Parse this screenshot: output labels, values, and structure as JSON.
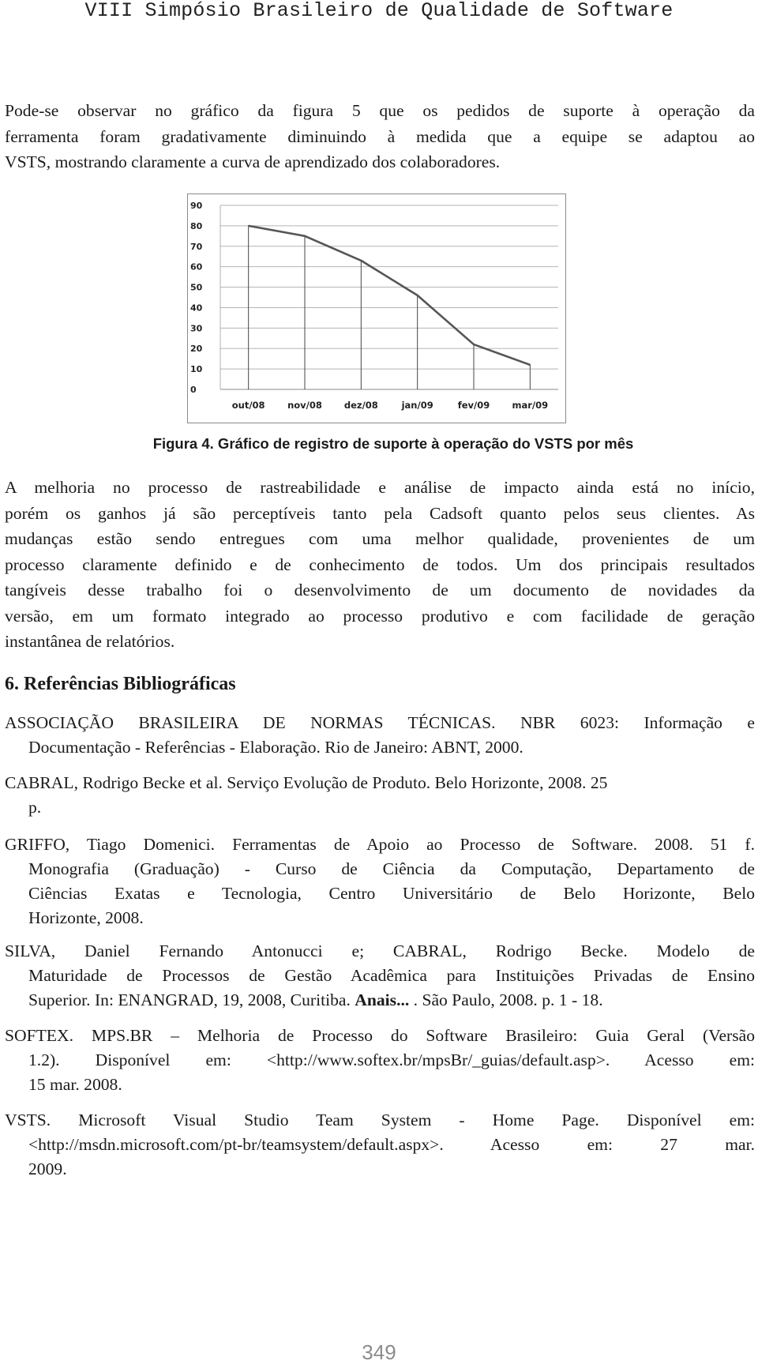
{
  "running_head": "VIII Simpósio Brasileiro de Qualidade de Software",
  "intro_paragraph": {
    "lines": [
      "Pode-se observar no gráfico da figura 5 que os pedidos de suporte à operação da",
      "ferramenta foram gradativamente diminuindo à medida que a equipe se adaptou ao",
      "VSTS, mostrando claramente a curva de aprendizado dos colaboradores."
    ]
  },
  "figure": {
    "caption": "Figura 4. Gráfico de registro de suporte à operação do VSTS por mês",
    "line_color": "#555555",
    "grid_color": "#b5b5b5",
    "drop_line_color": "#444444"
  },
  "chart_data": {
    "type": "line",
    "title": "",
    "xlabel": "",
    "ylabel": "",
    "categories": [
      "out/08",
      "nov/08",
      "dez/08",
      "jan/09",
      "fev/09",
      "mar/09"
    ],
    "values": [
      80,
      75,
      63,
      46,
      22,
      12
    ],
    "ylim": [
      0,
      90
    ],
    "yticks": [
      "0",
      "10",
      "20",
      "30",
      "40",
      "50",
      "60",
      "70",
      "80",
      "90"
    ],
    "grid": true,
    "legend": "none",
    "drop_lines": true
  },
  "body_paragraph": {
    "lines": [
      "A melhoria no processo de rastreabilidade e análise de impacto ainda está no início,",
      "porém os ganhos já são perceptíveis tanto pela Cadsoft quanto pelos seus clientes. As",
      "mudanças estão sendo entregues com uma melhor qualidade, provenientes de um",
      "processo claramente definido e de conhecimento de todos. Um dos principais resultados",
      "tangíveis desse trabalho foi o desenvolvimento de um documento de novidades da",
      "versão, em um formato integrado ao processo produtivo e com facilidade de geração",
      "instantânea de relatórios."
    ]
  },
  "references": {
    "title": "6. Referências Bibliográficas",
    "entries": [
      {
        "lines": [
          "ASSOCIAÇÃO BRASILEIRA DE NORMAS TÉCNICAS. NBR 6023: Informação e",
          "Documentação - Referências - Elaboração. Rio de Janeiro: ABNT, 2000."
        ]
      },
      {
        "lines": [
          "CABRAL, Rodrigo Becke et al. Serviço Evolução de Produto. Belo Horizonte, 2008. 25",
          "p."
        ]
      },
      {
        "lines": [
          "GRIFFO, Tiago Domenici. Ferramentas de Apoio ao Processo de Software. 2008. 51 f.",
          "Monografia (Graduação) - Curso de Ciência da Computação, Departamento de",
          "Ciências Exatas e Tecnologia, Centro Universitário de Belo Horizonte, Belo",
          "Horizonte, 2008."
        ]
      },
      {
        "lines": [
          "SILVA, Daniel Fernando Antonucci e; CABRAL, Rodrigo Becke. Modelo de",
          "Maturidade de Processos de Gestão Acadêmica para Instituições Privadas de Ensino"
        ],
        "last_line": {
          "before": "Superior. In: ENANGRAD, 19, 2008, Curitiba. ",
          "bold": "Anais...",
          "after": " . São Paulo, 2008. p. 1 - 18."
        }
      },
      {
        "lines": [
          "SOFTEX. MPS.BR – Melhoria de Processo do Software Brasileiro: Guia Geral (Versão",
          "1.2). Disponível em: <http://www.softex.br/mpsBr/_guias/default.asp>. Acesso em:",
          "15 mar. 2008."
        ]
      },
      {
        "lines": [
          "VSTS. Microsoft Visual Studio Team System - Home Page. Disponível em:",
          "<http://msdn.microsoft.com/pt-br/teamsystem/default.aspx>. Acesso em: 27 mar.",
          "2009."
        ]
      }
    ]
  },
  "page_number": "349"
}
